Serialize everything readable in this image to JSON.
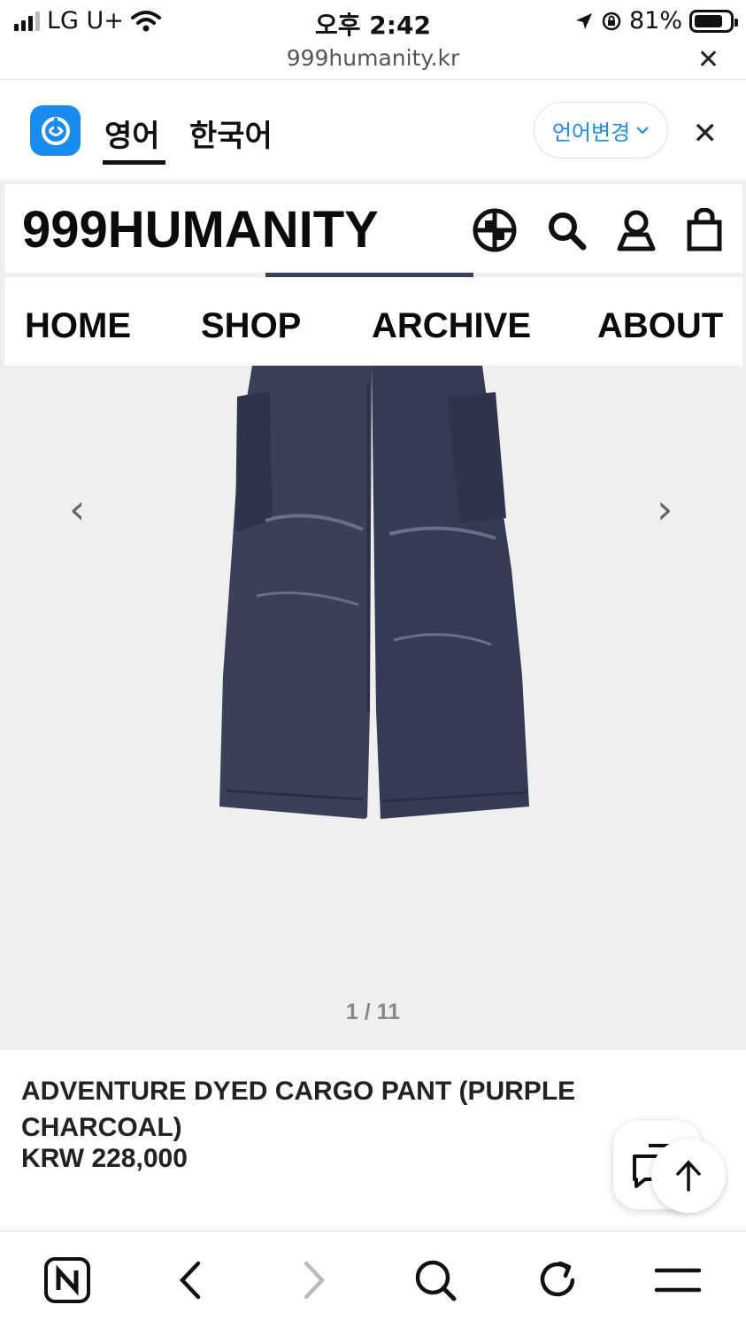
{
  "status_bar": {
    "carrier": "LG U+",
    "time": "오후 2:42",
    "battery": "81%",
    "battery_level": 0.81
  },
  "browser": {
    "url": "999humanity.kr",
    "close_icon": "close-icon"
  },
  "translate_bar": {
    "tab_english": "영어",
    "tab_korean": "한국어",
    "change_language": "언어변경",
    "close_icon": "close-icon"
  },
  "site": {
    "brand": "999HUMANITY",
    "icons": [
      "globe-icon",
      "search-icon",
      "account-icon",
      "bag-icon"
    ],
    "nav": [
      "HOME",
      "SHOP",
      "ARCHIVE",
      "ABOUT"
    ]
  },
  "gallery": {
    "counter": "1 / 11",
    "prev_icon": "chevron-left-icon",
    "next_icon": "chevron-right-icon",
    "background": "#efefef",
    "product_color": "#3a3f58"
  },
  "product": {
    "name": "ADVENTURE DYED CARGO PANT (PURPLE CHARCOAL)",
    "price": "KRW 228,000"
  },
  "floating": {
    "chat_icon": "chat-icon",
    "scroll_top_icon": "arrow-up-icon"
  },
  "toolbar": {
    "items": [
      "naver-home-icon",
      "back-icon",
      "forward-icon",
      "search-icon",
      "refresh-icon",
      "menu-icon"
    ]
  }
}
